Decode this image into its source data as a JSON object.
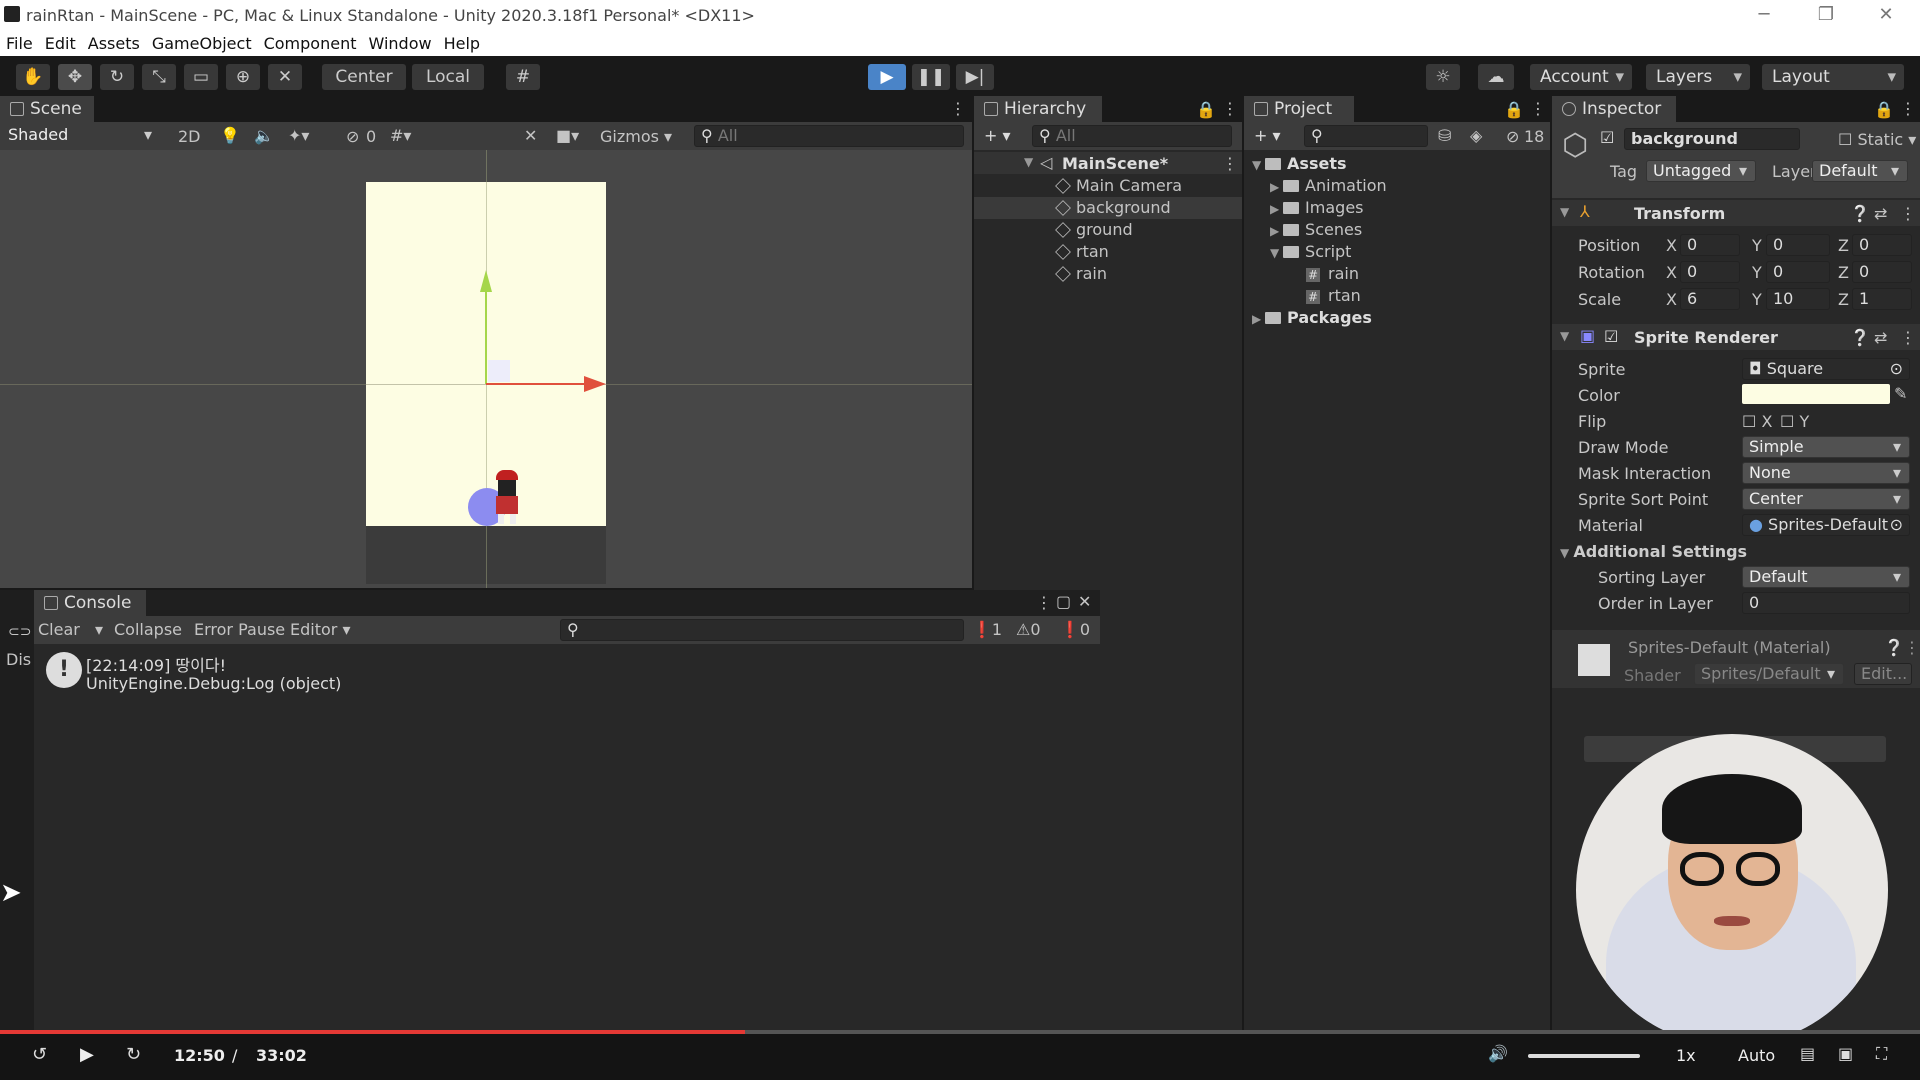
{
  "window": {
    "title": "rainRtan - MainScene - PC, Mac & Linux Standalone - Unity 2020.3.18f1 Personal* <DX11>",
    "minimize": "─",
    "maximize": "❐",
    "close": "✕"
  },
  "menu": [
    "File",
    "Edit",
    "Assets",
    "GameObject",
    "Component",
    "Window",
    "Help"
  ],
  "toolbar": {
    "pivot": "Center",
    "space": "Local",
    "account": "Account",
    "layers": "Layers",
    "layout": "Layout"
  },
  "scene": {
    "tab": "Scene",
    "shading": "Shaded",
    "mode2d": "2D",
    "hidden_count": "0",
    "gizmos": "Gizmos",
    "search_placeholder": "All",
    "bg_color": "#fdfde3"
  },
  "hierarchy": {
    "tab": "Hierarchy",
    "search_placeholder": "All",
    "scene": "MainScene*",
    "items": [
      "Main Camera",
      "background",
      "ground",
      "rtan",
      "rain"
    ]
  },
  "project": {
    "tab": "Project",
    "badge": "18",
    "root": "Assets",
    "folders": [
      "Animation",
      "Images",
      "Scenes",
      "Script"
    ],
    "scripts": [
      "rain",
      "rtan"
    ],
    "packages": "Packages"
  },
  "inspector": {
    "tab": "Inspector",
    "object_name": "background",
    "static": "Static",
    "tag_label": "Tag",
    "tag": "Untagged",
    "layer_label": "Layer",
    "layer": "Default",
    "transform": {
      "title": "Transform",
      "rows": [
        {
          "label": "Position",
          "x": "0",
          "y": "0",
          "z": "0"
        },
        {
          "label": "Rotation",
          "x": "0",
          "y": "0",
          "z": "0"
        },
        {
          "label": "Scale",
          "x": "6",
          "y": "10",
          "z": "1"
        }
      ]
    },
    "sprite_renderer": {
      "title": "Sprite Renderer",
      "sprite_label": "Sprite",
      "sprite": "Square",
      "color_label": "Color",
      "color": "#fdfde3",
      "flip_label": "Flip",
      "flip_x": "X",
      "flip_y": "Y",
      "draw_mode_label": "Draw Mode",
      "draw_mode": "Simple",
      "mask_label": "Mask Interaction",
      "mask": "None",
      "sort_point_label": "Sprite Sort Point",
      "sort_point": "Center",
      "material_label": "Material",
      "material": "Sprites-Default",
      "additional": "Additional Settings",
      "sorting_layer_label": "Sorting Layer",
      "sorting_layer": "Default",
      "order_label": "Order in Layer",
      "order": "0"
    },
    "material": {
      "name": "Sprites-Default (Material)",
      "shader_label": "Shader",
      "shader": "Sprites/Default",
      "edit": "Edit..."
    }
  },
  "console": {
    "tab": "Console",
    "clear": "Clear",
    "collapse": "Collapse",
    "error_pause": "Error Pause",
    "editor": "Editor",
    "count_log": "1",
    "count_warn": "0",
    "count_err": "0",
    "side_label": "Dis",
    "entry_line1": "[22:14:09] 땅이다!",
    "entry_line2": "UnityEngine.Debug:Log (object)"
  },
  "player": {
    "current": "12:50",
    "sep": "/",
    "duration": "33:02",
    "speed": "1x",
    "quality": "Auto",
    "progress": 0.388
  }
}
